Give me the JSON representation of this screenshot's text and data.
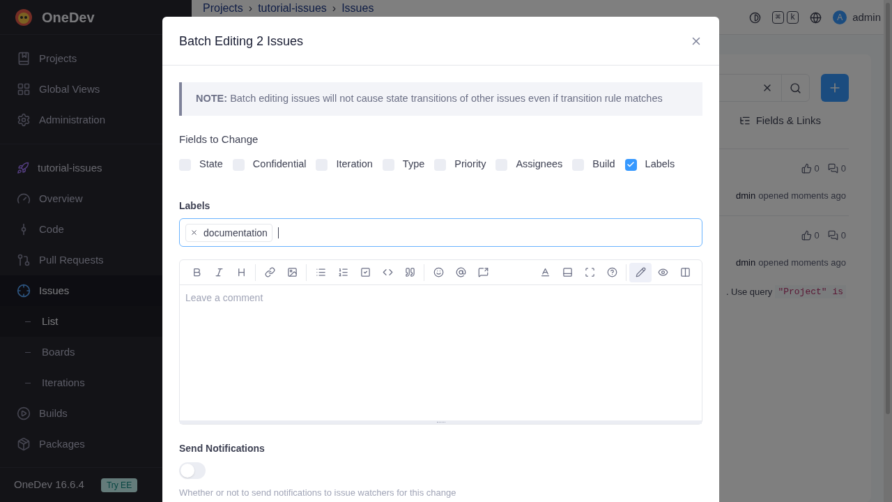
{
  "app": {
    "name": "OneDev",
    "version": "OneDev 16.6.4",
    "badge": "Try EE"
  },
  "sidebar": {
    "global_items": [
      {
        "kind": "projects",
        "label": "Projects"
      },
      {
        "kind": "views",
        "label": "Global Views"
      },
      {
        "kind": "admin",
        "label": "Administration"
      }
    ],
    "project": "tutorial-issues",
    "project_items": [
      {
        "kind": "overview",
        "label": "Overview",
        "selected": false
      },
      {
        "kind": "code",
        "label": "Code",
        "selected": false
      },
      {
        "kind": "pulls",
        "label": "Pull Requests",
        "selected": false
      },
      {
        "kind": "issues",
        "label": "Issues",
        "selected": true,
        "children": [
          {
            "label": "List",
            "selected": true
          },
          {
            "label": "Boards",
            "selected": false
          },
          {
            "label": "Iterations",
            "selected": false
          }
        ]
      },
      {
        "kind": "builds",
        "label": "Builds",
        "selected": false
      },
      {
        "kind": "packages",
        "label": "Packages",
        "selected": false
      }
    ]
  },
  "header": {
    "breadcrumb": [
      "Projects",
      "tutorial-issues",
      "Issues"
    ],
    "separator": "›",
    "keys": [
      "⌘",
      "k"
    ],
    "avatar": "A",
    "user": "admin"
  },
  "issue_list": {
    "fields_links": "Fields & Links",
    "rows": [
      {
        "likes": "0",
        "comments": "0",
        "author": "dmin",
        "meta": "opened moments ago"
      },
      {
        "likes": "0",
        "comments": "0",
        "author": "dmin",
        "meta": "opened moments ago"
      }
    ],
    "hint": ". Use query",
    "hint_code": "\"Project\" is"
  },
  "dialog": {
    "title": "Batch Editing 2 Issues",
    "note_label": "NOTE:",
    "note": "Batch editing issues will not cause state transitions of other issues even if transition rule matches",
    "fields_title": "Fields to Change",
    "fields": [
      {
        "label": "State",
        "checked": false
      },
      {
        "label": "Confidential",
        "checked": false
      },
      {
        "label": "Iteration",
        "checked": false
      },
      {
        "label": "Type",
        "checked": false
      },
      {
        "label": "Priority",
        "checked": false
      },
      {
        "label": "Assignees",
        "checked": false
      },
      {
        "label": "Build",
        "checked": false
      },
      {
        "label": "Labels",
        "checked": true
      }
    ],
    "labels_title": "Labels",
    "labels": [
      "documentation"
    ],
    "editor": {
      "placeholder": "Leave a comment",
      "modes": [
        {
          "kind": "edit",
          "selected": true
        },
        {
          "kind": "preview",
          "selected": false
        },
        {
          "kind": "split",
          "selected": false
        }
      ]
    },
    "notify_title": "Send Notifications",
    "notify_on": false,
    "notify_help": "Whether or not to send notifications to issue watchers for this change"
  }
}
